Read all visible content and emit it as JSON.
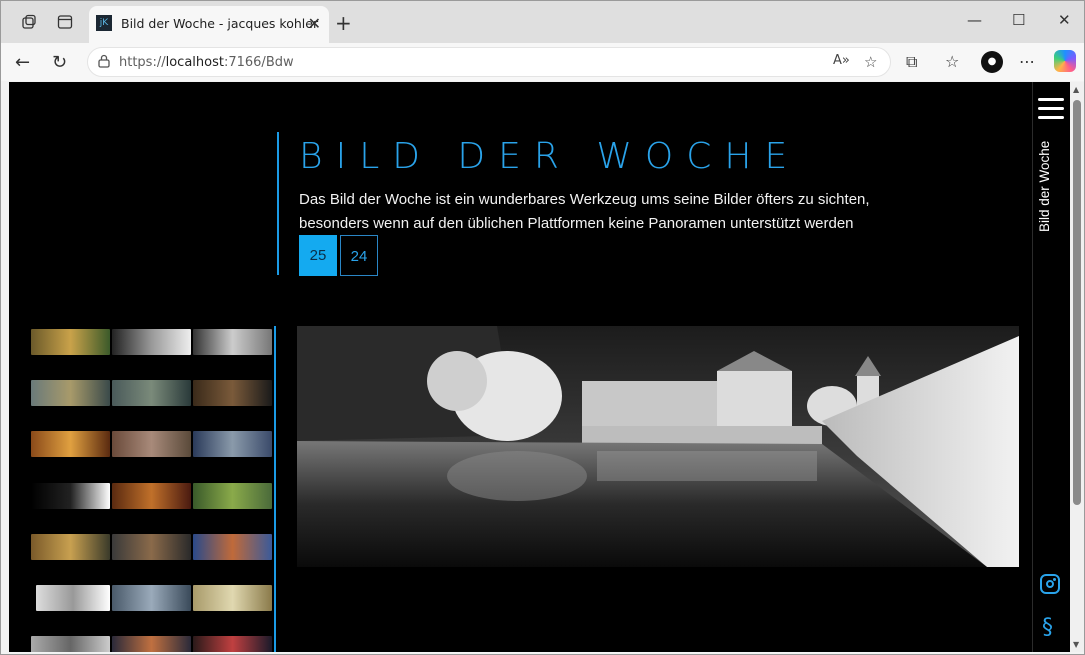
{
  "browser": {
    "tab_title": "Bild der Woche - jacques kohler",
    "tab_favicon_text": "jK",
    "url_scheme": "https://",
    "url_host": "localhost",
    "url_rest": ":7166/Bdw"
  },
  "page": {
    "title": "BILD DER WOCHE",
    "description": "Das Bild der Woche ist ein wunderbares Werkzeug ums seine Bilder öfters zu sichten, besonders wenn auf den üblichen Plattformen keine Panoramen unterstützt werden",
    "years": [
      {
        "label": "25",
        "active": true
      },
      {
        "label": "24",
        "active": false
      }
    ]
  },
  "sidebar": {
    "label": "Bild der Woche",
    "menu_icon": "hamburger-icon",
    "social_icon": "instagram-icon",
    "legal_icon": "paragraph-icon",
    "legal_glyph": "§"
  },
  "colors": {
    "accent": "#2aa3ea",
    "active_button": "#14aaf0",
    "background": "#000000"
  }
}
